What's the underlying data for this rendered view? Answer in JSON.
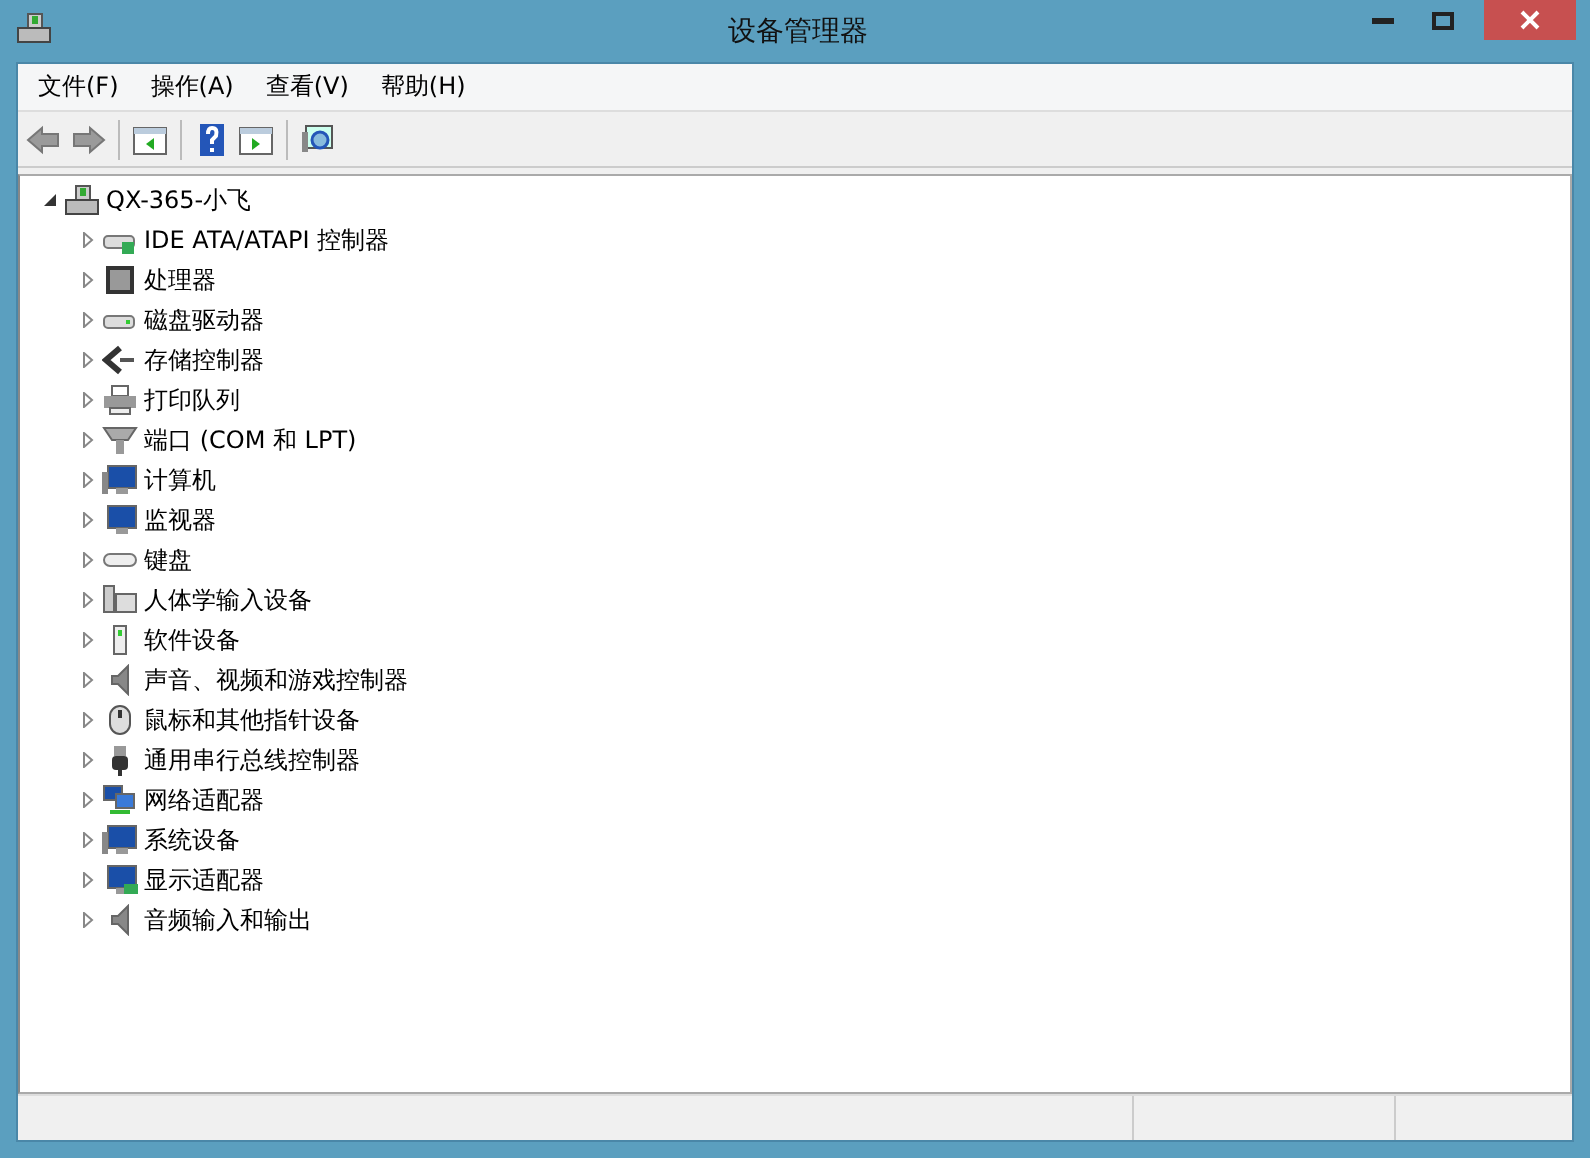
{
  "window": {
    "title": "设备管理器"
  },
  "menu": [
    {
      "label": "文件(F)"
    },
    {
      "label": "操作(A)"
    },
    {
      "label": "查看(V)"
    },
    {
      "label": "帮助(H)"
    }
  ],
  "toolbar": [
    {
      "kind": "back",
      "disabled": true
    },
    {
      "kind": "forward",
      "disabled": true
    },
    {
      "kind": "separator"
    },
    {
      "kind": "console",
      "disabled": false
    },
    {
      "kind": "separator"
    },
    {
      "kind": "help",
      "disabled": false
    },
    {
      "kind": "pane",
      "disabled": false
    },
    {
      "kind": "separator"
    },
    {
      "kind": "scan",
      "disabled": false
    }
  ],
  "tree": {
    "label": "QX-365-小飞",
    "expanded": true,
    "children": [
      {
        "label": "IDE ATA/ATAPI 控制器",
        "kind": "ide",
        "expanded": false
      },
      {
        "label": "处理器",
        "kind": "cpu",
        "expanded": false
      },
      {
        "label": "磁盘驱动器",
        "kind": "disk",
        "expanded": false
      },
      {
        "label": "存储控制器",
        "kind": "storage",
        "expanded": false
      },
      {
        "label": "打印队列",
        "kind": "printer",
        "expanded": false
      },
      {
        "label": "端口 (COM 和 LPT)",
        "kind": "port",
        "expanded": false
      },
      {
        "label": "计算机",
        "kind": "computer",
        "expanded": false
      },
      {
        "label": "监视器",
        "kind": "monitor",
        "expanded": false
      },
      {
        "label": "键盘",
        "kind": "keyboard",
        "expanded": false
      },
      {
        "label": "人体学输入设备",
        "kind": "hid",
        "expanded": false
      },
      {
        "label": "软件设备",
        "kind": "software",
        "expanded": false
      },
      {
        "label": "声音、视频和游戏控制器",
        "kind": "sound",
        "expanded": false
      },
      {
        "label": "鼠标和其他指针设备",
        "kind": "mouse",
        "expanded": false
      },
      {
        "label": "通用串行总线控制器",
        "kind": "usb",
        "expanded": false
      },
      {
        "label": "网络适配器",
        "kind": "network",
        "expanded": false
      },
      {
        "label": "系统设备",
        "kind": "computer",
        "expanded": false
      },
      {
        "label": "显示适配器",
        "kind": "display",
        "expanded": false
      },
      {
        "label": "音频输入和输出",
        "kind": "sound",
        "expanded": false
      }
    ]
  }
}
